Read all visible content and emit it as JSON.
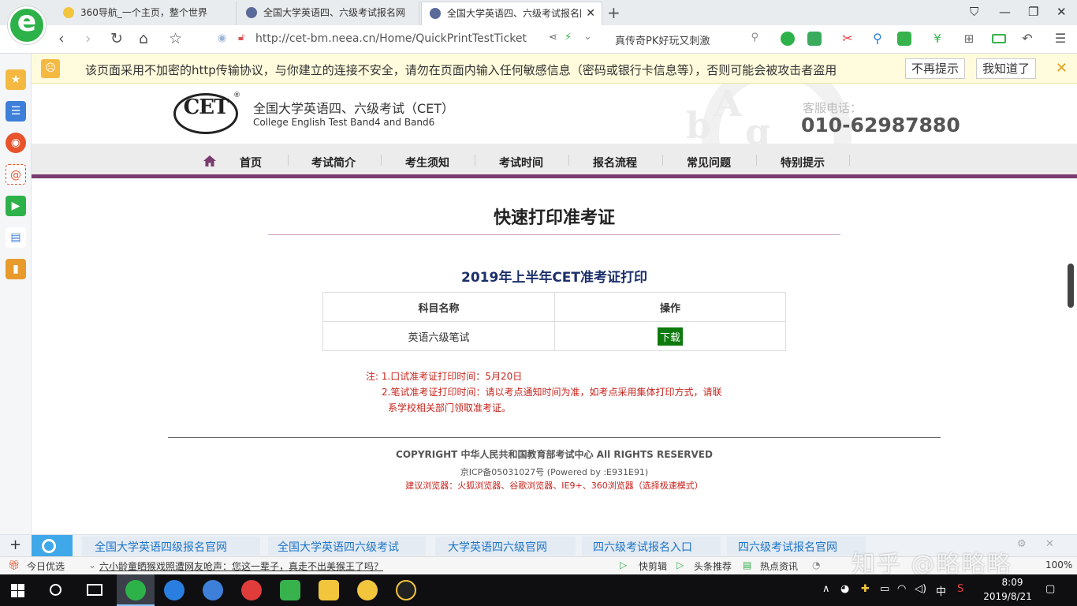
{
  "browser": {
    "tabs": [
      {
        "title": "360导航_一个主页，整个世界"
      },
      {
        "title": "全国大学英语四、六级考试报名网"
      },
      {
        "title": "全国大学英语四、六级考试报名网"
      }
    ],
    "url": "http://cet-bm.neea.cn/Home/QuickPrintTestTicket",
    "search_text": "真传奇PK好玩又刺激"
  },
  "security_bar": {
    "message": "该页面采用不加密的http传输协议，与你建立的连接不安全，请勿在页面内输入任何敏感信息（密码或银行卡信息等），否则可能会被攻击者盗用",
    "dont_remind": "不再提示",
    "got_it": "我知道了"
  },
  "site": {
    "logo_text": "CET",
    "title_cn": "全国大学英语四、六级考试（CET）",
    "title_en": "College English Test Band4 and Band6",
    "hotline_label": "客服电话：",
    "hotline_number": "010-62987880",
    "nav": [
      "首页",
      "考试简介",
      "考生须知",
      "考试时间",
      "报名流程",
      "常见问题",
      "特别提示"
    ]
  },
  "main": {
    "page_title": "快速打印准考证",
    "section_title": "2019年上半年CET准考证打印",
    "table": {
      "headers": [
        "科目名称",
        "操作"
      ],
      "rows": [
        {
          "subject": "英语六级笔试",
          "action": "下载"
        }
      ]
    },
    "notes": [
      "注: 1.口试准考证打印时间：5月20日",
      "2.笔试准考证打印时间：请以考点通知时间为准，如考点采用集体打印方式，请联",
      "系学校相关部门领取准考证。"
    ]
  },
  "footer": {
    "copyright": "COPYRIGHT 中华人民共和国教育部考试中心 All RIGHTS RESERVED",
    "icp": "京ICP备05031027号 (Powered by :E931E91)",
    "browser_tip": "建议浏览器：火狐浏览器、谷歌浏览器、IE9+、360浏览器（选择极速模式）"
  },
  "link_bar": {
    "links": [
      "全国大学英语四级报名官网",
      "全国大学英语四六级考试",
      "大学英语四六级官网",
      "四六级考试报名入口",
      "四六级考试报名官网"
    ]
  },
  "status_bar": {
    "today_label": "今日优选",
    "headline": "六小龄童晒猴戏照遭网友呛声：您这一辈子，真走不出美猴王了吗？",
    "quick_clip": "快剪辑",
    "headline_rec": "头条推荐",
    "hot_news": "热点资讯",
    "zoom": "100%"
  },
  "watermark": "知乎 @略略略",
  "taskbar": {
    "time": "8:09",
    "date": "2019/8/21",
    "ime": "中"
  },
  "colors": {
    "accent_purple": "#7a3b6e",
    "download_green": "#0c7a0c",
    "note_red": "#c8241d",
    "link_blue": "#1e74c8"
  }
}
